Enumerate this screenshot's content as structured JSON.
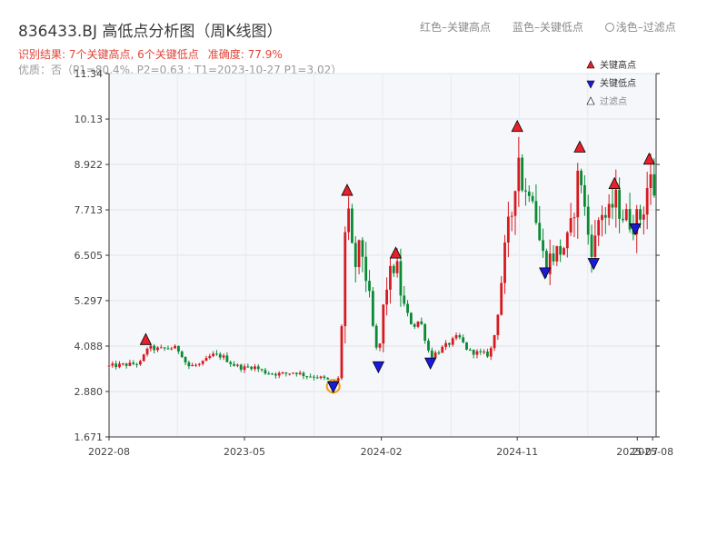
{
  "chart_data": {
    "type": "candlestick",
    "title": "836433.BJ 高低点分析图（周K线图）",
    "subtitle_result": "识别结果: 7个关键高点, 6个关键低点",
    "subtitle_accuracy": "准确度: 77.9%",
    "subtitle_quality": "优质：否（P1=80.4%, P2=0.63 ; T1=2023-10-27 P1=3.02）",
    "legend_top": {
      "red": "红色–关键高点",
      "blue": "蓝色–关键低点",
      "light": "浅色–过滤点"
    },
    "legend": [
      {
        "label": "关键高点",
        "marker": "triangle-up",
        "color": "#e8202a"
      },
      {
        "label": "关键低点",
        "marker": "triangle-down",
        "color": "#1a1adc"
      },
      {
        "label": "过滤点",
        "marker": "triangle-up-hollow",
        "color": "#888888"
      }
    ],
    "y_ticks": [
      "1.671",
      "2.880",
      "4.088",
      "5.297",
      "6.505",
      "7.713",
      "8.922",
      "10.13",
      "11.34"
    ],
    "ylim": [
      1.671,
      11.34
    ],
    "x_ticks": [
      {
        "label": "2022-08",
        "date": "2022-08-01"
      },
      {
        "label": "2023-05",
        "date": "2023-05-01"
      },
      {
        "label": "2024-02",
        "date": "2024-02-01"
      },
      {
        "label": "2024-11",
        "date": "2024-11-01"
      },
      {
        "label": "2025-07",
        "date": "2025-07-01"
      },
      {
        "label": "2025-08",
        "date": "2025-08-01"
      }
    ],
    "xlim": [
      "2022-08-01",
      "2025-08-08"
    ],
    "filtered_marker": {
      "date": "2023-10-27",
      "price": 3.02
    },
    "key_highs": [
      {
        "date": "2022-10-14",
        "price": 4.25
      },
      {
        "date": "2023-11-24",
        "price": 8.22
      },
      {
        "date": "2024-03-01",
        "price": 6.55
      },
      {
        "date": "2024-11-01",
        "price": 9.92
      },
      {
        "date": "2025-03-07",
        "price": 9.37
      },
      {
        "date": "2025-05-16",
        "price": 8.4
      },
      {
        "date": "2025-07-25",
        "price": 9.05
      }
    ],
    "key_lows": [
      {
        "date": "2023-10-27",
        "price": 3.02
      },
      {
        "date": "2024-01-26",
        "price": 3.55
      },
      {
        "date": "2024-05-10",
        "price": 3.65
      },
      {
        "date": "2024-12-27",
        "price": 6.05
      },
      {
        "date": "2025-04-04",
        "price": 6.3
      },
      {
        "date": "2025-06-27",
        "price": 7.22
      }
    ],
    "close_path": [
      [
        "2022-08-01",
        3.55
      ],
      [
        "2022-08-22",
        3.58
      ],
      [
        "2022-09-12",
        3.6
      ],
      [
        "2022-10-07",
        3.65
      ],
      [
        "2022-10-14",
        4.05
      ],
      [
        "2022-11-11",
        4.0
      ],
      [
        "2022-12-09",
        4.05
      ],
      [
        "2022-12-23",
        3.95
      ],
      [
        "2023-01-06",
        3.55
      ],
      [
        "2023-02-03",
        3.6
      ],
      [
        "2023-02-24",
        3.85
      ],
      [
        "2023-03-17",
        3.82
      ],
      [
        "2023-04-07",
        3.6
      ],
      [
        "2023-04-28",
        3.5
      ],
      [
        "2023-05-19",
        3.55
      ],
      [
        "2023-06-09",
        3.4
      ],
      [
        "2023-06-30",
        3.35
      ],
      [
        "2023-07-21",
        3.35
      ],
      [
        "2023-08-11",
        3.4
      ],
      [
        "2023-09-01",
        3.3
      ],
      [
        "2023-09-22",
        3.28
      ],
      [
        "2023-10-13",
        3.2
      ],
      [
        "2023-10-27",
        3.12
      ],
      [
        "2023-11-10",
        3.25
      ],
      [
        "2023-11-17",
        6.5
      ],
      [
        "2023-11-24",
        7.8
      ],
      [
        "2023-12-08",
        6.1
      ],
      [
        "2023-12-22",
        6.8
      ],
      [
        "2024-01-05",
        5.6
      ],
      [
        "2024-01-19",
        4.2
      ],
      [
        "2024-01-26",
        3.75
      ],
      [
        "2024-02-09",
        5.6
      ],
      [
        "2024-02-23",
        6.1
      ],
      [
        "2024-03-01",
        6.35
      ],
      [
        "2024-03-15",
        5.2
      ],
      [
        "2024-04-05",
        4.6
      ],
      [
        "2024-04-19",
        4.8
      ],
      [
        "2024-05-03",
        4.1
      ],
      [
        "2024-05-10",
        3.8
      ],
      [
        "2024-05-31",
        4.0
      ],
      [
        "2024-06-21",
        4.2
      ],
      [
        "2024-07-05",
        4.35
      ],
      [
        "2024-07-26",
        3.95
      ],
      [
        "2024-08-16",
        3.9
      ],
      [
        "2024-09-06",
        3.85
      ],
      [
        "2024-09-20",
        4.6
      ],
      [
        "2024-09-27",
        5.5
      ],
      [
        "2024-10-11",
        7.0
      ],
      [
        "2024-10-25",
        7.9
      ],
      [
        "2024-11-01",
        9.5
      ],
      [
        "2024-11-15",
        8.0
      ],
      [
        "2024-11-29",
        8.6
      ],
      [
        "2024-12-13",
        7.1
      ],
      [
        "2024-12-27",
        6.25
      ],
      [
        "2025-01-10",
        6.5
      ],
      [
        "2025-01-24",
        6.6
      ],
      [
        "2025-02-14",
        6.9
      ],
      [
        "2025-03-07",
        8.9
      ],
      [
        "2025-03-21",
        7.2
      ],
      [
        "2025-04-04",
        6.6
      ],
      [
        "2025-04-18",
        7.8
      ],
      [
        "2025-05-02",
        7.4
      ],
      [
        "2025-05-16",
        8.0
      ],
      [
        "2025-06-06",
        7.5
      ],
      [
        "2025-06-27",
        7.4
      ],
      [
        "2025-07-11",
        7.6
      ],
      [
        "2025-07-25",
        8.6
      ],
      [
        "2025-08-08",
        8.1
      ]
    ]
  }
}
